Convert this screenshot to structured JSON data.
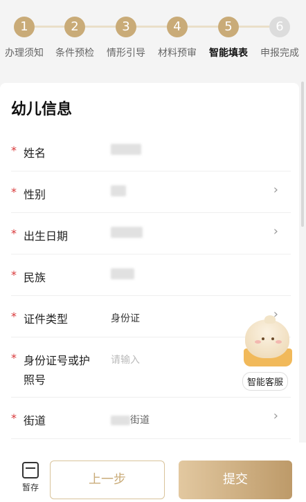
{
  "steps": [
    {
      "num": "1",
      "label": "办理须知"
    },
    {
      "num": "2",
      "label": "条件预检"
    },
    {
      "num": "3",
      "label": "情形引导"
    },
    {
      "num": "4",
      "label": "材料预审"
    },
    {
      "num": "5",
      "label": "智能填表"
    },
    {
      "num": "6",
      "label": "申报完成"
    }
  ],
  "form": {
    "title": "幼儿信息",
    "required_mark": "*",
    "fields": {
      "name": {
        "label": "姓名"
      },
      "gender": {
        "label": "性别"
      },
      "birthdate": {
        "label": "出生日期"
      },
      "ethnicity": {
        "label": "民族"
      },
      "id_type": {
        "label": "证件类型",
        "value": "身份证"
      },
      "id_number": {
        "label_line1": "身份证号或护",
        "label_line2": "照号",
        "placeholder": "请输入"
      },
      "street": {
        "label": "街道",
        "value_suffix": "街道"
      }
    },
    "chevron": "›"
  },
  "assistant": {
    "label": "智能客服"
  },
  "bottom": {
    "save_label": "暂存",
    "prev_label": "上一步",
    "submit_label": "提交"
  }
}
